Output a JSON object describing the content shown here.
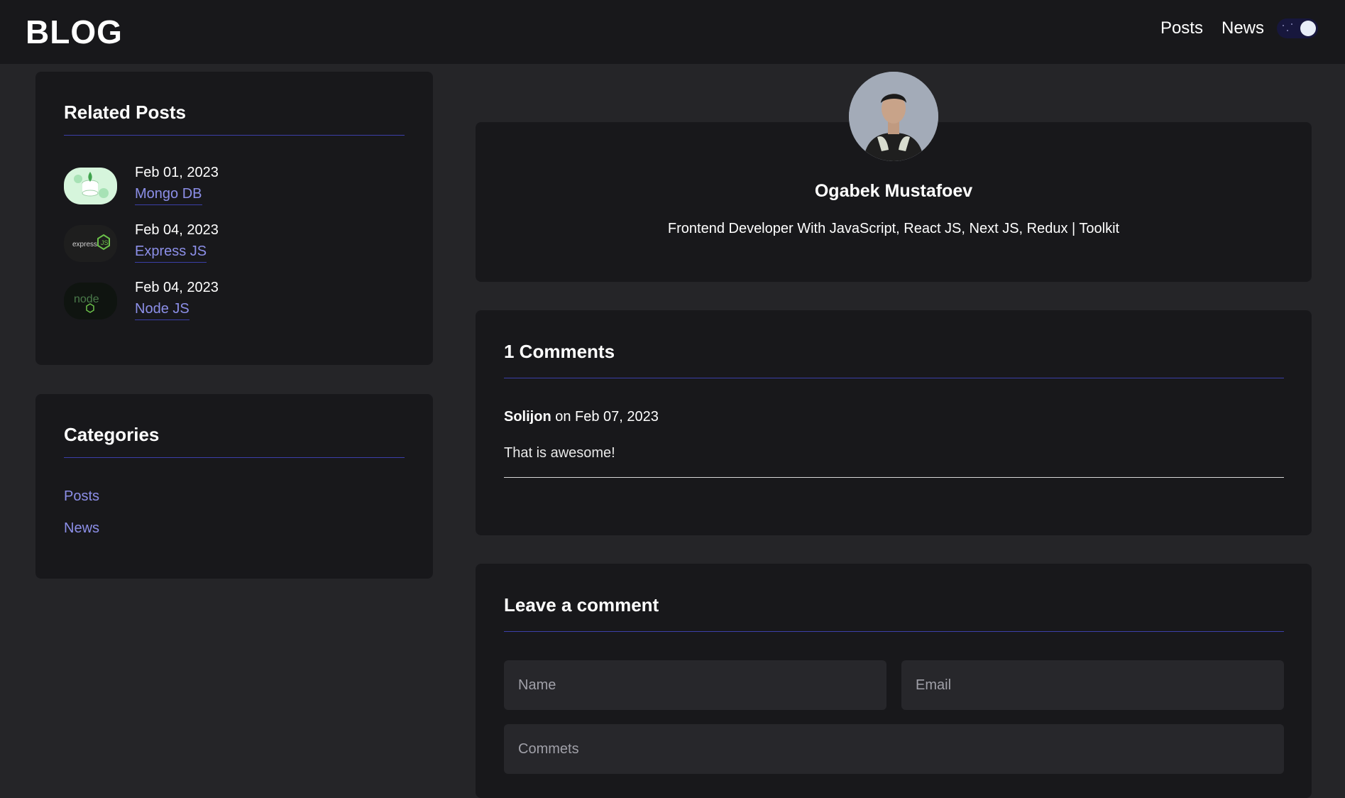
{
  "header": {
    "logo": "BLOG",
    "nav": [
      {
        "label": "Posts"
      },
      {
        "label": "News"
      }
    ],
    "theme_toggle": {
      "state": "dark"
    }
  },
  "sidebar": {
    "related": {
      "title": "Related Posts",
      "posts": [
        {
          "date": "Feb 01, 2023",
          "title": "Mongo DB",
          "thumb_icon": "mongodb-icon"
        },
        {
          "date": "Feb 04, 2023",
          "title": "Express JS",
          "thumb_icon": "express-js-icon"
        },
        {
          "date": "Feb 04, 2023",
          "title": "Node JS",
          "thumb_icon": "node-js-icon"
        }
      ]
    },
    "categories": {
      "title": "Categories",
      "items": [
        {
          "label": "Posts"
        },
        {
          "label": "News"
        }
      ]
    }
  },
  "author": {
    "name": "Ogabek Mustafoev",
    "bio": "Frontend Developer With JavaScript, React JS, Next JS, Redux | Toolkit"
  },
  "comments": {
    "title": "1 Comments",
    "items": [
      {
        "author": "Solijon",
        "date_text": "on Feb 07, 2023",
        "text": "That is awesome!"
      }
    ]
  },
  "comment_form": {
    "title": "Leave a comment",
    "name_placeholder": "Name",
    "email_placeholder": "Email",
    "comment_placeholder": "Commets"
  },
  "colors": {
    "page_bg": "#252528",
    "card_bg": "#18181b",
    "accent_link": "#8c8fe8",
    "divider": "#3b3fa8"
  }
}
